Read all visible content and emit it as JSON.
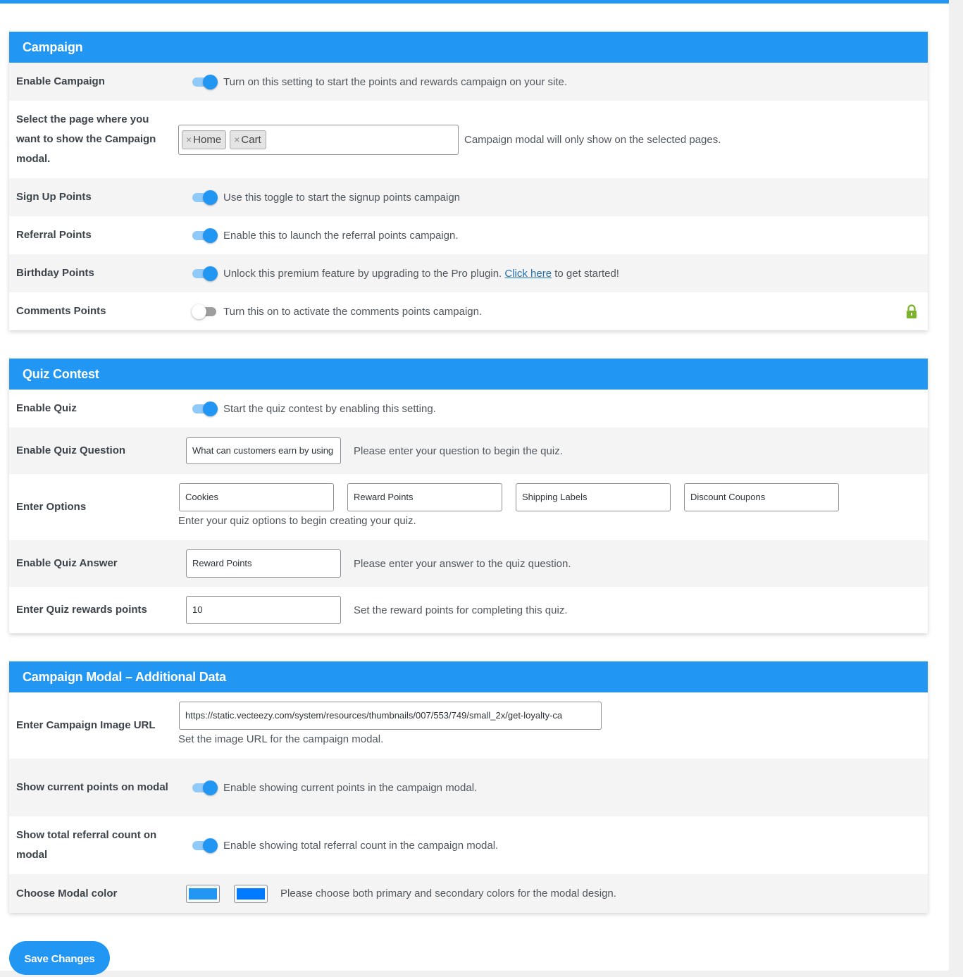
{
  "campaign": {
    "title": "Campaign",
    "enable_campaign": {
      "label": "Enable Campaign",
      "desc": "Turn on this setting to start the points and rewards campaign on your site.",
      "enabled": true
    },
    "select_page": {
      "label": "Select the page where you want to show the Campaign modal.",
      "chips": [
        "Home",
        "Cart"
      ],
      "chip_remove": "×",
      "desc": "Campaign modal will only show on the selected pages."
    },
    "signup_points": {
      "label": "Sign Up Points",
      "desc": "Use this toggle to start the signup points campaign",
      "enabled": true
    },
    "referral_points": {
      "label": "Referral Points",
      "desc": "Enable this to launch the referral points campaign.",
      "enabled": true
    },
    "birthday_points": {
      "label": "Birthday Points",
      "desc_before": "Unlock this premium feature by upgrading to the Pro plugin.",
      "link_text": "Click here",
      "desc_after": "to get started!",
      "enabled": true
    },
    "comments_points": {
      "label": "Comments Points",
      "desc": "Turn this on to activate the comments points campaign.",
      "enabled": false,
      "lock_icon": "lock-icon"
    }
  },
  "quiz": {
    "title": "Quiz Contest",
    "enable_quiz": {
      "label": "Enable Quiz",
      "desc": "Start the quiz contest by enabling this setting.",
      "enabled": true
    },
    "question": {
      "label": "Enable Quiz Question",
      "value": "What can customers earn by using",
      "desc": "Please enter your question to begin the quiz."
    },
    "options": {
      "label": "Enter Options",
      "values": [
        "Cookies",
        "Reward Points",
        "Shipping Labels",
        "Discount Coupons"
      ],
      "desc": "Enter your quiz options to begin creating your quiz."
    },
    "answer": {
      "label": "Enable Quiz Answer",
      "value": "Reward Points",
      "desc": "Please enter your answer to the quiz question."
    },
    "reward_points": {
      "label": "Enter Quiz rewards points",
      "value": "10",
      "desc": "Set the reward points for completing this quiz."
    }
  },
  "modal": {
    "title": "Campaign Modal – Additional Data",
    "image_url": {
      "label": "Enter Campaign Image URL",
      "value": "https://static.vecteezy.com/system/resources/thumbnails/007/553/749/small_2x/get-loyalty-ca",
      "desc": "Set the image URL for the campaign modal."
    },
    "current_points": {
      "label": "Show current points on modal",
      "desc": "Enable showing current points in the campaign modal.",
      "enabled": true
    },
    "referral_count": {
      "label": "Show total referral count on modal",
      "desc": "Enable showing total referral count in the campaign modal.",
      "enabled": true
    },
    "modal_color": {
      "label": "Choose Modal color",
      "primary": "#2196f3",
      "secondary": "#007bff",
      "desc": "Please choose both primary and secondary colors for the modal design."
    }
  },
  "save_button": "Save Changes",
  "colors": {
    "accent": "#2196f3",
    "lock": "#7ab42a"
  }
}
